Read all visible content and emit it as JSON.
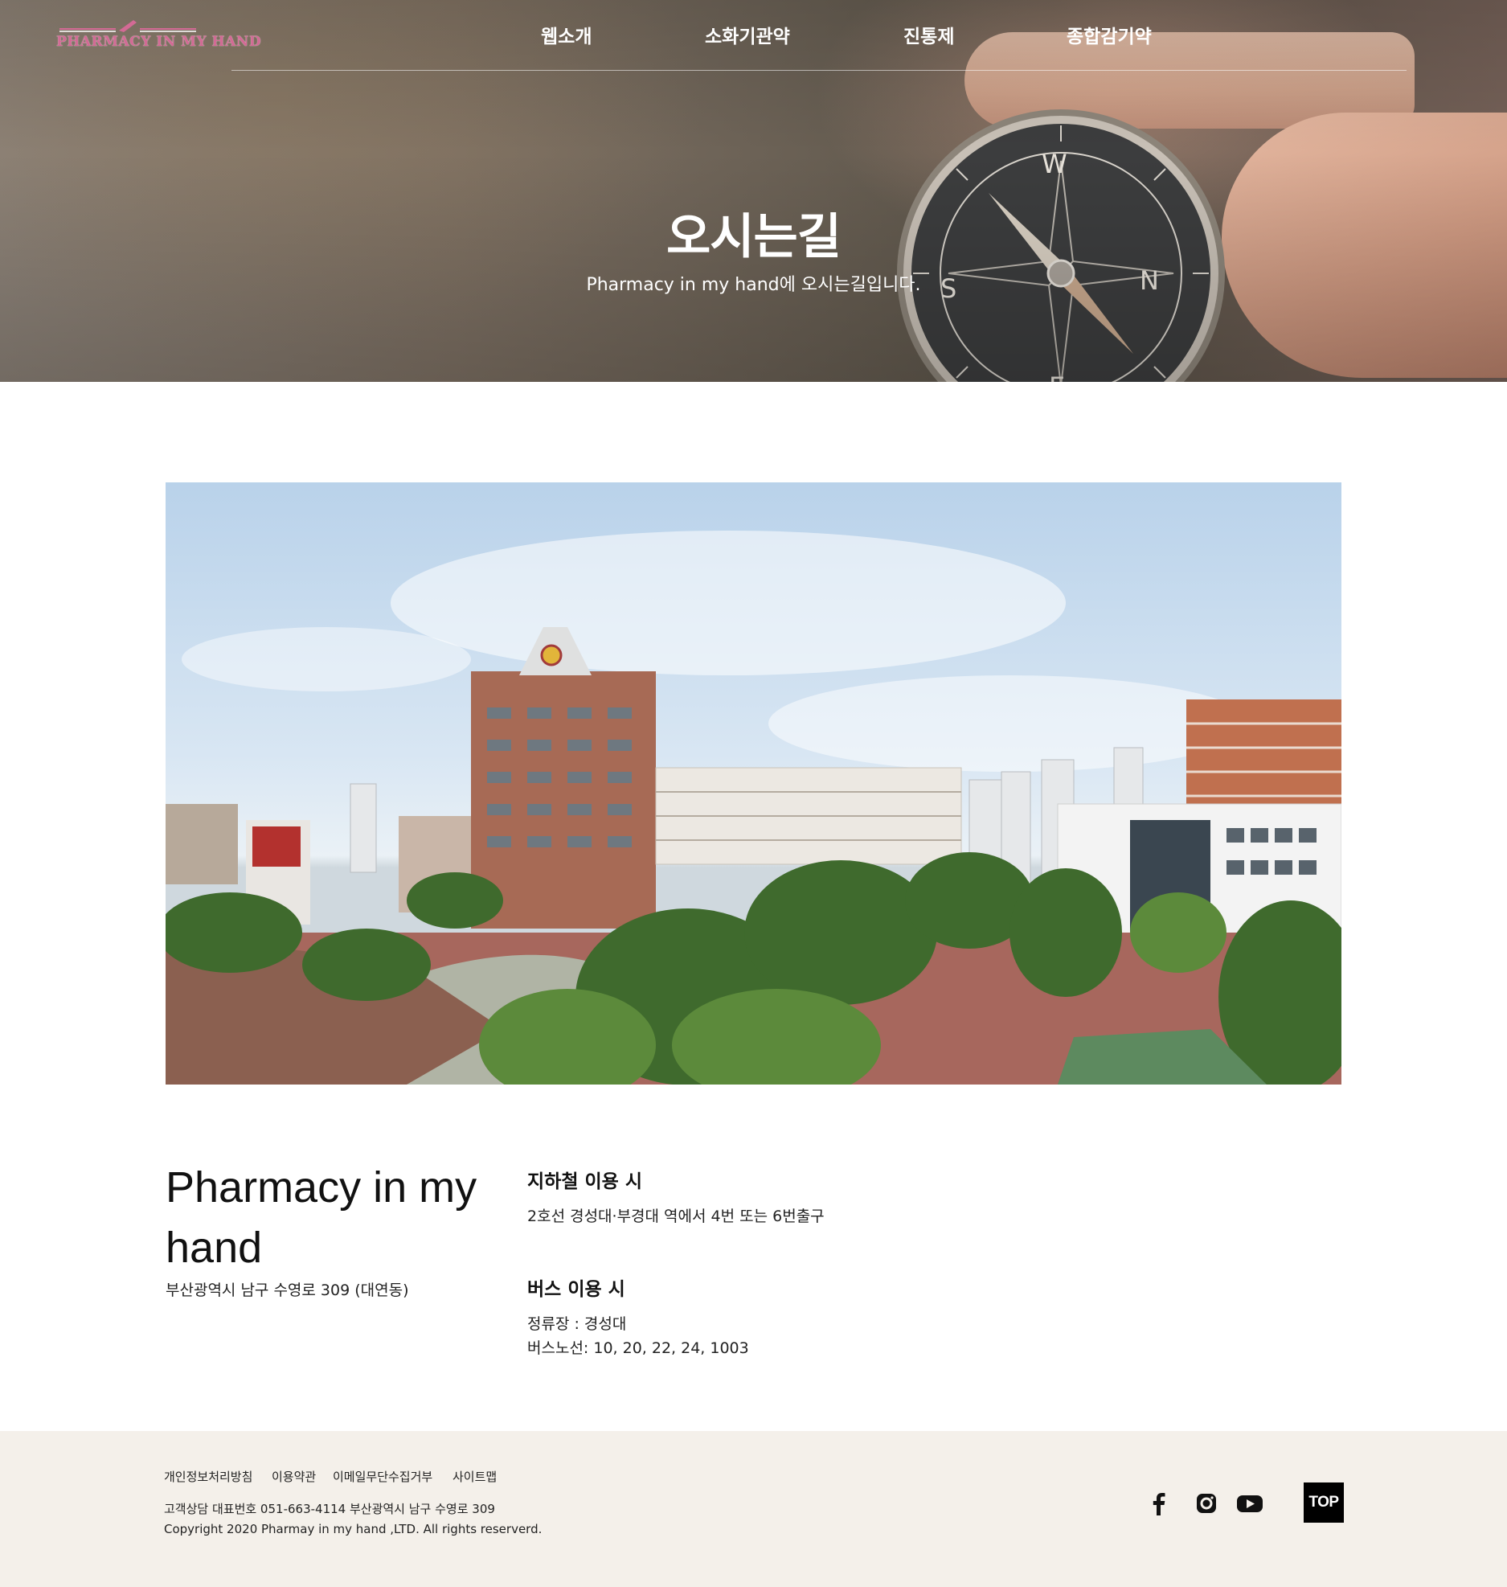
{
  "brand": {
    "logo_text": "PHARMACY IN MY HAND",
    "accent": "#d36a95"
  },
  "nav": {
    "items": [
      "웹소개",
      "소화기관약",
      "진통제",
      "종합감기약"
    ]
  },
  "hero": {
    "title": "오시는길",
    "subtitle": "Pharmacy in my hand에 오시는길입니다."
  },
  "info": {
    "title": "Pharmacy in my hand",
    "address": "부산광역시 남구 수영로 309 (대연동)",
    "subway": {
      "heading": "지하철 이용 시",
      "detail": "2호선 경성대·부경대 역에서 4번 또는 6번출구"
    },
    "bus": {
      "heading": "버스 이용 시",
      "stop": "정류장 : 경성대",
      "routes": "버스노선: 10, 20, 22, 24, 1003"
    }
  },
  "footer": {
    "links": [
      "개인정보처리방침",
      "이용약관",
      "이메일무단수집거부",
      "사이트맵"
    ],
    "contact": "고객상담 대표번호 051-663-4114 부산광역시 남구 수영로 309",
    "copyright": "Copyright 2020 Pharmay in my hand ,LTD. All rights reserverd.",
    "social_icons": [
      "facebook-icon",
      "instagram-icon",
      "youtube-icon"
    ],
    "top_label": "TOP",
    "background": "#f4f0ea"
  }
}
